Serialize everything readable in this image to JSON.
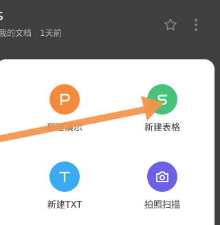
{
  "header": {
    "doc_title": "s",
    "doc_location": "我的文档",
    "doc_time": "1天前",
    "star_icon": "star-outline-icon",
    "more_icon": "more-icon"
  },
  "sheet": {
    "actions": [
      {
        "label": "新建演示",
        "icon": "presentation-p-icon",
        "color": "#f58a3d"
      },
      {
        "label": "新建表格",
        "icon": "spreadsheet-s-icon",
        "color": "#48c17a"
      },
      {
        "label": "新建TXT",
        "icon": "text-t-icon",
        "color": "#3aaaf3"
      },
      {
        "label": "拍照扫描",
        "icon": "camera-icon",
        "color": "#6a5fe6"
      }
    ]
  },
  "overlay": {
    "annotation": "arrow-annotation",
    "color": "#f4924a"
  }
}
